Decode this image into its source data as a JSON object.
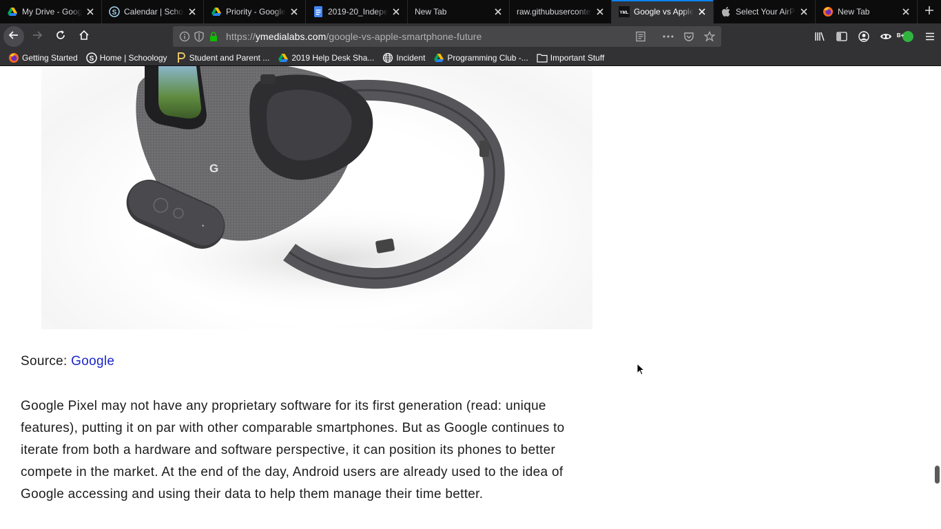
{
  "browser": {
    "tabs": [
      {
        "title": "My Drive - Goog",
        "icon": "google-drive-icon"
      },
      {
        "title": "Calendar | Schoo",
        "icon": "schoology-icon"
      },
      {
        "title": "Priority - Google",
        "icon": "google-drive-icon"
      },
      {
        "title": "2019-20_Indepe",
        "icon": "google-docs-icon"
      },
      {
        "title": "New Tab",
        "icon": ""
      },
      {
        "title": "raw.githubuserconte",
        "icon": ""
      },
      {
        "title": "Google vs Apple",
        "icon": "ymedialabs-icon",
        "active": true
      },
      {
        "title": "Select Your AirPo",
        "icon": "apple-icon"
      },
      {
        "title": "New Tab",
        "icon": "firefox-icon"
      }
    ],
    "url": {
      "prefix": "https://",
      "host": "ymedialabs.com",
      "path": "/google-vs-apple-smartphone-future"
    },
    "bookmarks": [
      {
        "label": "Getting Started",
        "icon": "firefox-icon"
      },
      {
        "label": "Home | Schoology",
        "icon": "schoology-icon"
      },
      {
        "label": "Student and Parent ...",
        "icon": "portal-icon"
      },
      {
        "label": "2019 Help Desk Sha...",
        "icon": "google-drive-icon"
      },
      {
        "label": "Incident",
        "icon": "globe-icon"
      },
      {
        "label": "Programming Club -...",
        "icon": "google-drive-icon"
      },
      {
        "label": "Important Stuff",
        "icon": "folder-icon"
      }
    ],
    "profile_badge": "B+",
    "accent": "#0a84ff"
  },
  "article": {
    "source_label": "Source: ",
    "source_link": "Google",
    "paragraph": "Google Pixel may not have any proprietary software for its first generation (read: unique features), putting it on par with other comparable smartphones. But as Google continues to iterate from both a hardware and software perspective, it can position its phones to better compete in the market. At the end of the day, Android users are already used to the idea of Google accessing and using their data to help them manage their time better.",
    "image_alt": "Google Daydream View VR headset with controller",
    "headset_logo": "G",
    "link_color": "#1a25cc"
  }
}
